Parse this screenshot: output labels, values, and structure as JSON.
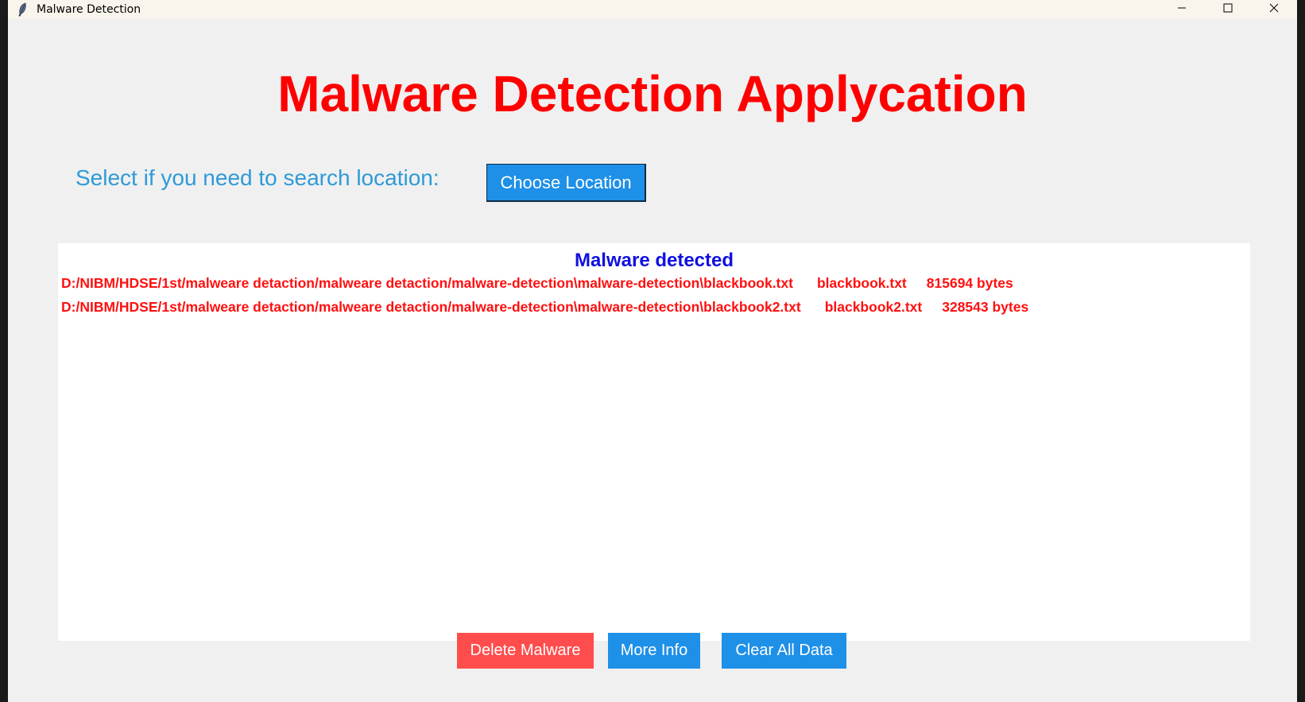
{
  "window": {
    "title": "Malware Detection"
  },
  "app": {
    "heading": "Malware Detection Applycation",
    "select_label": "Select if you need to search location:",
    "choose_button": "Choose Location"
  },
  "results": {
    "title": "Malware detected",
    "rows": [
      {
        "path": "D:/NIBM/HDSE/1st/malweare detaction/malweare detaction/malware-detection\\malware-detection\\blackbook.txt",
        "name": "blackbook.txt",
        "size": "815694 bytes"
      },
      {
        "path": "D:/NIBM/HDSE/1st/malweare detaction/malweare detaction/malware-detection\\malware-detection\\blackbook2.txt",
        "name": "blackbook2.txt",
        "size": "328543 bytes"
      }
    ]
  },
  "actions": {
    "delete": "Delete Malware",
    "more_info": "More Info",
    "clear": "Clear All Data"
  },
  "colors": {
    "heading": "#ff0000",
    "label": "#2e9ad8",
    "primary_button": "#1e90e8",
    "danger_button": "#ff4d4d",
    "results_title": "#1010e0",
    "result_text": "#ff1010"
  },
  "icons": [
    "feather-icon",
    "minimize-icon",
    "maximize-icon",
    "close-icon"
  ]
}
